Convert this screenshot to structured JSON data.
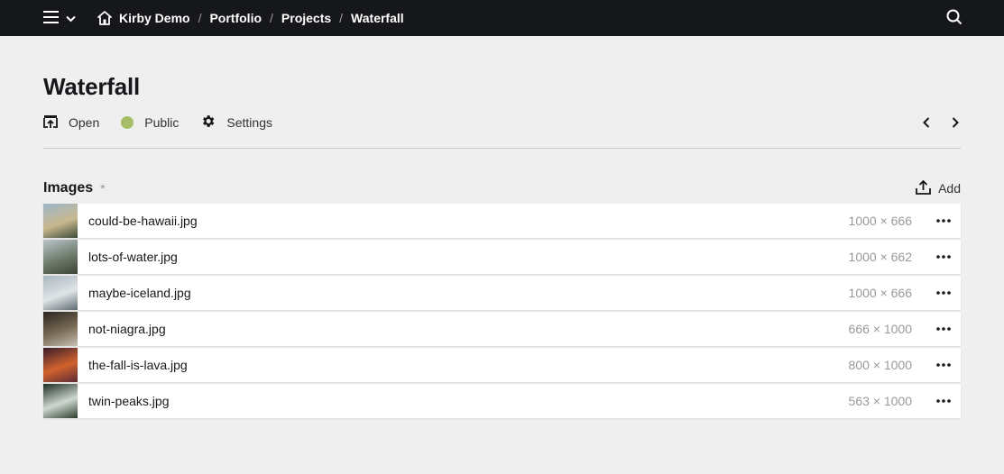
{
  "breadcrumb": {
    "site": "Kirby Demo",
    "items": [
      "Portfolio",
      "Projects",
      "Waterfall"
    ],
    "separator": "/"
  },
  "page": {
    "title": "Waterfall",
    "actions": {
      "open": "Open",
      "status": "Public",
      "settings": "Settings"
    },
    "status_color": "#a7bd68"
  },
  "section": {
    "title": "Images",
    "required_marker": "*",
    "add_label": "Add"
  },
  "files": [
    {
      "name": "could-be-hawaii.jpg",
      "dims": "1000 × 666",
      "thumb": [
        "#9db5c9",
        "#c8b98f",
        "#3d4a3a"
      ]
    },
    {
      "name": "lots-of-water.jpg",
      "dims": "1000 × 662",
      "thumb": [
        "#b9c5cc",
        "#6e7b6a",
        "#3e4536"
      ]
    },
    {
      "name": "maybe-iceland.jpg",
      "dims": "1000 × 666",
      "thumb": [
        "#a9b6bf",
        "#dfe4e6",
        "#5d6a70"
      ]
    },
    {
      "name": "not-niagra.jpg",
      "dims": "666 × 1000",
      "thumb": [
        "#2b2620",
        "#7a6b55",
        "#c7c1b5"
      ]
    },
    {
      "name": "the-fall-is-lava.jpg",
      "dims": "800 × 1000",
      "thumb": [
        "#3a1d2b",
        "#d0632e",
        "#5c2a35"
      ]
    },
    {
      "name": "twin-peaks.jpg",
      "dims": "563 × 1000",
      "thumb": [
        "#1f2f24",
        "#cfd8d0",
        "#2c3d2e"
      ]
    }
  ]
}
